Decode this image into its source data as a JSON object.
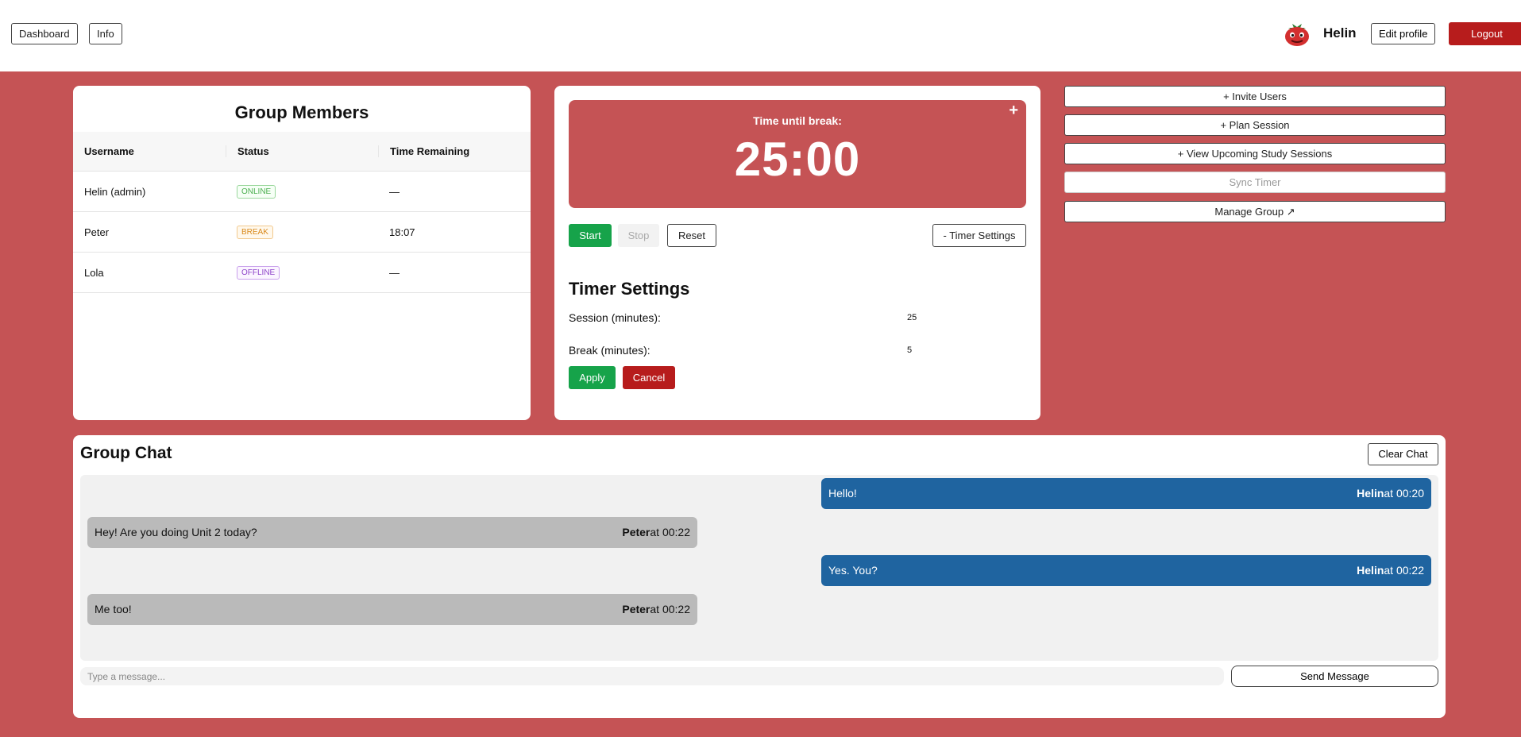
{
  "topbar": {
    "dashboard_label": "Dashboard",
    "info_label": "Info",
    "username": "Helin",
    "edit_profile_label": "Edit profile",
    "logout_label": "Logout",
    "avatar_icon": "tomato-avatar-icon"
  },
  "members": {
    "title": "Group Members",
    "columns": [
      "Username",
      "Status",
      "Time Remaining"
    ],
    "rows": [
      {
        "username": "Helin (admin)",
        "status": "ONLINE",
        "time": "—"
      },
      {
        "username": "Peter",
        "status": "BREAK",
        "time": "18:07"
      },
      {
        "username": "Lola",
        "status": "OFFLINE",
        "time": "—"
      }
    ]
  },
  "timer": {
    "label": "Time until break:",
    "value": "25:00",
    "expand_icon": "plus-icon",
    "start_label": "Start",
    "stop_label": "Stop",
    "reset_label": "Reset",
    "settings_toggle_label": "- Timer Settings",
    "settings": {
      "title": "Timer Settings",
      "session_label": "Session (minutes):",
      "session_value": "25",
      "break_label": "Break (minutes):",
      "break_value": "5",
      "apply_label": "Apply",
      "cancel_label": "Cancel"
    }
  },
  "actions": {
    "invite_label": "+ Invite Users",
    "plan_label": "+ Plan Session",
    "view_label": "+ View Upcoming Study Sessions",
    "sync_label": "Sync Timer",
    "manage_label": "Manage Group ↗"
  },
  "chat": {
    "title": "Group Chat",
    "clear_label": "Clear Chat",
    "messages": [
      {
        "text": "Hello!",
        "author": "Helin",
        "time": "at 00:20"
      },
      {
        "text": "Hey! Are you doing Unit 2 today?",
        "author": "Peter",
        "time": "at 00:22"
      },
      {
        "text": "Yes. You?",
        "author": "Helin",
        "time": "at 00:22"
      },
      {
        "text": "Me too!",
        "author": "Peter",
        "time": "at 00:22"
      }
    ],
    "input_placeholder": "Type a message...",
    "send_label": "Send Message"
  },
  "colors": {
    "page_background": "#c55355",
    "own_message": "#1f64a0",
    "other_message": "#bababa",
    "start_green": "#16a34a",
    "danger_red": "#b71c1c"
  }
}
